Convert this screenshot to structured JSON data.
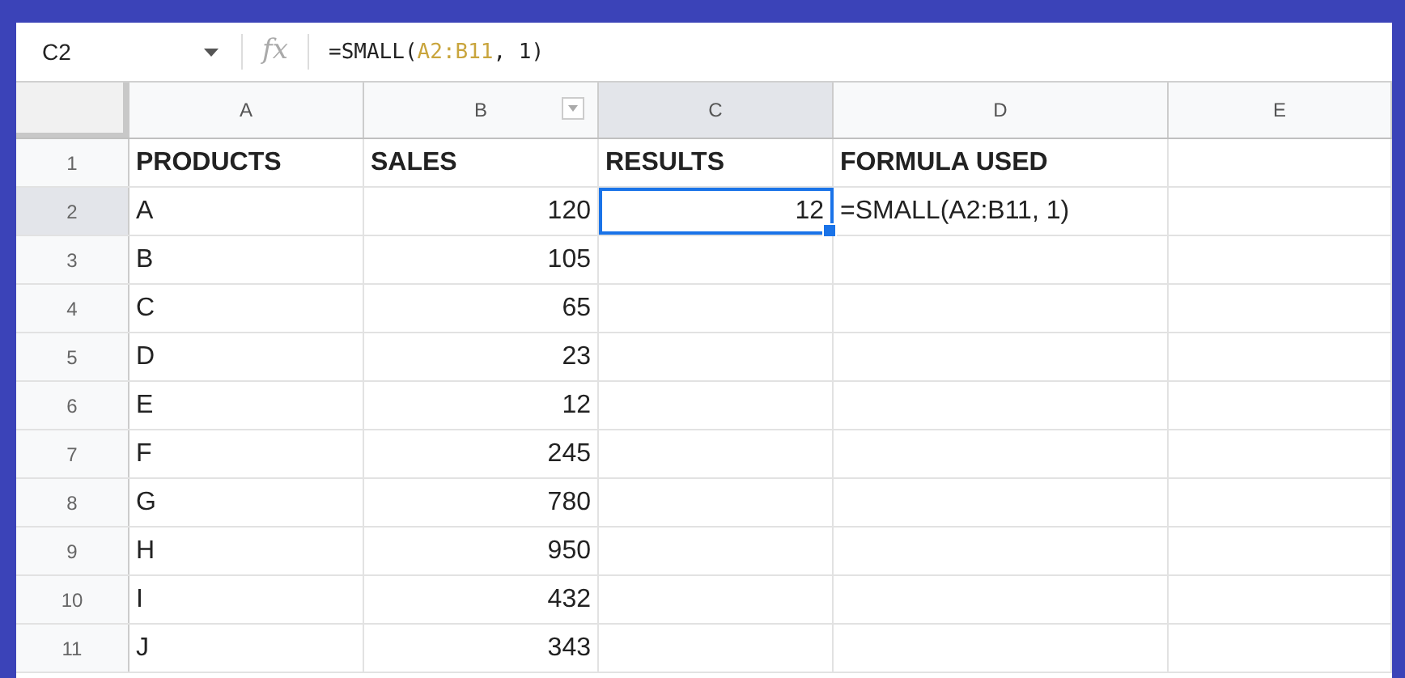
{
  "name_box": {
    "value": "C2"
  },
  "formula_bar": {
    "label": "fx",
    "before": "=SMALL(",
    "range": "A2:B11",
    "after": ", 1)"
  },
  "columns": [
    {
      "label": "A",
      "selected": false,
      "filter": false
    },
    {
      "label": "B",
      "selected": false,
      "filter": true
    },
    {
      "label": "C",
      "selected": true,
      "filter": false
    },
    {
      "label": "D",
      "selected": false,
      "filter": false
    },
    {
      "label": "E",
      "selected": false,
      "filter": false
    }
  ],
  "rows": [
    {
      "number": "1",
      "selected": false,
      "cells": [
        {
          "kind": "heading",
          "text": "PRODUCTS",
          "active": false
        },
        {
          "kind": "heading",
          "text": "SALES",
          "active": false
        },
        {
          "kind": "heading",
          "text": "RESULTS",
          "active": false
        },
        {
          "kind": "heading",
          "text": "FORMULA USED",
          "active": false
        }
      ]
    },
    {
      "number": "2",
      "selected": true,
      "cells": [
        {
          "kind": "label",
          "text": "A",
          "active": false
        },
        {
          "kind": "number",
          "text": "120",
          "active": false
        },
        {
          "kind": "number",
          "text": "12",
          "active": true
        },
        {
          "kind": "label",
          "text": "=SMALL(A2:B11, 1)",
          "active": false
        }
      ]
    },
    {
      "number": "3",
      "selected": false,
      "cells": [
        {
          "kind": "label",
          "text": "B",
          "active": false
        },
        {
          "kind": "number",
          "text": "105",
          "active": false
        }
      ]
    },
    {
      "number": "4",
      "selected": false,
      "cells": [
        {
          "kind": "label",
          "text": "C",
          "active": false
        },
        {
          "kind": "number",
          "text": "65",
          "active": false
        }
      ]
    },
    {
      "number": "5",
      "selected": false,
      "cells": [
        {
          "kind": "label",
          "text": "D",
          "active": false
        },
        {
          "kind": "number",
          "text": "23",
          "active": false
        }
      ]
    },
    {
      "number": "6",
      "selected": false,
      "cells": [
        {
          "kind": "label",
          "text": "E",
          "active": false
        },
        {
          "kind": "number",
          "text": "12",
          "active": false
        }
      ]
    },
    {
      "number": "7",
      "selected": false,
      "cells": [
        {
          "kind": "label",
          "text": "F",
          "active": false
        },
        {
          "kind": "number",
          "text": "245",
          "active": false
        }
      ]
    },
    {
      "number": "8",
      "selected": false,
      "cells": [
        {
          "kind": "label",
          "text": "G",
          "active": false
        },
        {
          "kind": "number",
          "text": "780",
          "active": false
        }
      ]
    },
    {
      "number": "9",
      "selected": false,
      "cells": [
        {
          "kind": "label",
          "text": "H",
          "active": false
        },
        {
          "kind": "number",
          "text": "950",
          "active": false
        }
      ]
    },
    {
      "number": "10",
      "selected": false,
      "cells": [
        {
          "kind": "label",
          "text": "I",
          "active": false
        },
        {
          "kind": "number",
          "text": "432",
          "active": false
        }
      ]
    },
    {
      "number": "11",
      "selected": false,
      "cells": [
        {
          "kind": "label",
          "text": "J",
          "active": false
        },
        {
          "kind": "number",
          "text": "343",
          "active": false
        }
      ]
    }
  ]
}
